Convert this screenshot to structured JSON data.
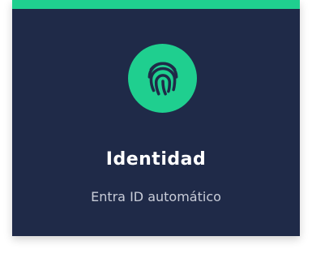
{
  "card": {
    "title": "Identidad",
    "subtitle": "Entra ID automático",
    "icon": "fingerprint-icon",
    "colors": {
      "accent": "#1fcf8f",
      "background": "#1f2a48",
      "title": "#ffffff",
      "subtitle": "#c8ccd8"
    }
  }
}
